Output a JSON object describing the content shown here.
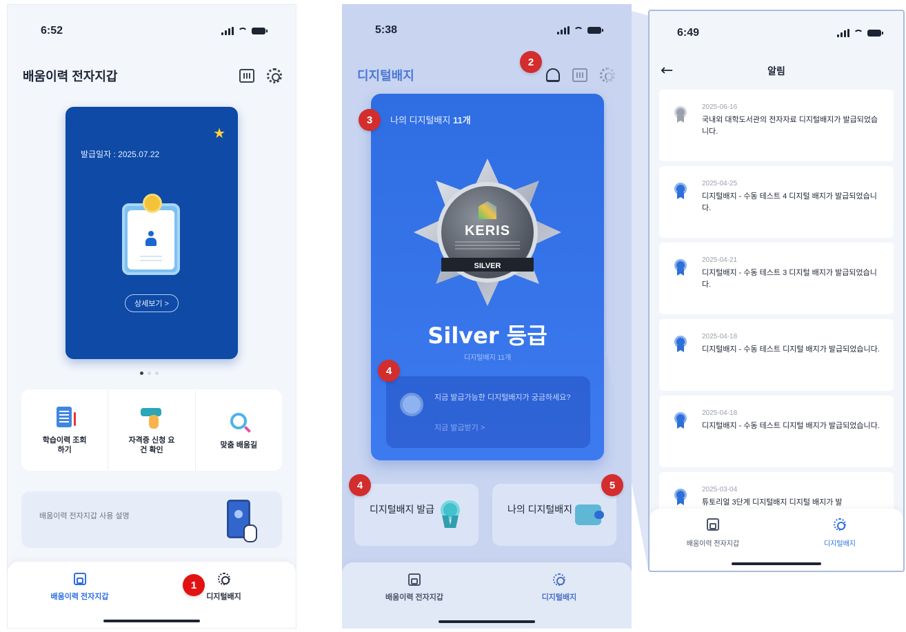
{
  "colors": {
    "accent_blue": "#2d6fe0",
    "card_navy": "#0e4aa6",
    "badge_card_blue": "#2f6de3",
    "marker_red": "#d32d2d",
    "overlay_lavender": "#c8d4f0"
  },
  "markers": [
    "1",
    "2",
    "3",
    "4",
    "4",
    "5"
  ],
  "screen1": {
    "status_time": "6:52",
    "title": "배움이력 전자지갑",
    "card": {
      "issue_date": "발급일자 : 2025.07.22",
      "detail_button": "상세보기 >",
      "icon": "id-card-badge-icon"
    },
    "menu": [
      {
        "label": "학습이력 조회하기",
        "icon": "clipboard-icon"
      },
      {
        "label": "자격증 신청 요건 확인",
        "icon": "hand-pointer-icon"
      },
      {
        "label": "맞춤 배움길",
        "icon": "magnifier-icon"
      }
    ],
    "guide": "배움이력 전자지갑 사용 설명",
    "tabs": [
      "배움이력 전자지갑",
      "디지털배지"
    ]
  },
  "screen2": {
    "status_time": "5:38",
    "title": "디지털배지",
    "badge_count_prefix": "나의 디지털배지",
    "badge_count": "11개",
    "emblem_brand": "KERIS",
    "emblem_tier": "SILVER",
    "grade": "Silver 등급",
    "grade_sub": "디지털배지 11개",
    "available_text": "지금 발급가능한 디지털배지가 궁금하세요?",
    "available_link": "지금 발급받기 >",
    "btn_issue": "디지털배지 발급",
    "btn_mine": "나의 디지털배지",
    "tabs": [
      "배움이력 전자지갑",
      "디지털배지"
    ]
  },
  "screen3": {
    "status_time": "6:49",
    "title": "알림",
    "notifications": [
      {
        "date": "2025-06-16",
        "text": "국내외 대학도서관의 전자자료 디지털배지가 발급되었습니다.",
        "status": "grey"
      },
      {
        "date": "2025-04-25",
        "text": "디지털배지 - 수동 테스트 4 디지털 배지가 발급되었습니다.",
        "status": "blue"
      },
      {
        "date": "2025-04-21",
        "text": "디지털배지 - 수동 테스트 3 디지털 배지가 발급되었습니다.",
        "status": "blue"
      },
      {
        "date": "2025-04-18",
        "text": "디지털배지 - 수동 테스트 디지털 배지가 발급되었습니다.",
        "status": "blue"
      },
      {
        "date": "2025-04-18",
        "text": "디지털배지 - 수동 테스트 디지털 배지가 발급되었습니다.",
        "status": "blue"
      },
      {
        "date": "2025-03-04",
        "text": "튜토리얼 3단계 디지털배지 디지털 배지가 발",
        "status": "blue"
      }
    ],
    "tabs": [
      "배움이력 전자지갑",
      "디지털배지"
    ]
  }
}
